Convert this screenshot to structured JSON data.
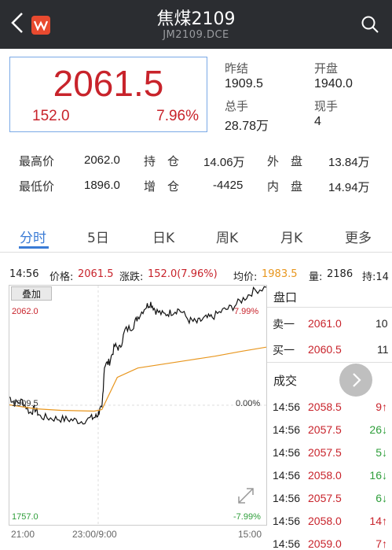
{
  "header": {
    "title": "焦煤2109",
    "subtitle": "JM2109.DCE",
    "logo_letter": "W"
  },
  "quote": {
    "price": "2061.5",
    "change": "152.0",
    "change_pct": "7.96%",
    "prev_close_label": "昨结",
    "prev_close": "1909.5",
    "open_label": "开盘",
    "open": "1940.0",
    "total_vol_label": "总手",
    "total_vol": "28.78万",
    "cur_vol_label": "现手",
    "cur_vol": "4"
  },
  "stats": {
    "high_label": "最高价",
    "high": "2062.0",
    "low_label": "最低价",
    "low": "1896.0",
    "oi_label": "持　仓",
    "oi": "14.06万",
    "oi_chg_label": "增　仓",
    "oi_chg": "-4425",
    "outer_label": "外　盘",
    "outer": "13.84万",
    "inner_label": "内　盘",
    "inner": "14.94万"
  },
  "tabs": [
    "分时",
    "5日",
    "日K",
    "周K",
    "月K",
    "更多"
  ],
  "infobar": {
    "time": "14:56",
    "price_label": "价格:",
    "price": "2061.5",
    "chg_label": "涨跌:",
    "chg": "152.0(7.96%)",
    "avg_label": "均价:",
    "avg": "1983.5",
    "vol_label": "量:",
    "vol": "2186",
    "oi_label": "持:14"
  },
  "chart": {
    "overlay_label": "叠加",
    "y_top": "2062.0",
    "y_mid": "1909.5",
    "y_bottom": "1757.0",
    "pct_top": "7.99%",
    "pct_mid": "0.00%",
    "pct_bottom": "-7.99%",
    "x_labels": [
      "21:00",
      "23:00/9:00",
      "15:00"
    ]
  },
  "chart_data": {
    "type": "line",
    "ylim": [
      1757.0,
      2062.0
    ],
    "xlabel": "",
    "ylabel": "",
    "x": [
      "21:00",
      "23:00/9:00",
      "15:00"
    ],
    "series": [
      {
        "color": "#111111"
      },
      {
        "color": "#e8961e"
      }
    ]
  },
  "orderbook": {
    "title": "盘口",
    "ask_label": "卖一",
    "ask_price": "2061.0",
    "ask_vol": "10",
    "bid_label": "买一",
    "bid_price": "2060.5",
    "bid_vol": "11"
  },
  "trades": {
    "title": "成交",
    "rows": [
      {
        "time": "14:56",
        "price": "2058.5",
        "vol": "9↑",
        "dir": "up"
      },
      {
        "time": "14:56",
        "price": "2057.5",
        "vol": "26↓",
        "dir": "down"
      },
      {
        "time": "14:56",
        "price": "2057.5",
        "vol": "5↓",
        "dir": "down"
      },
      {
        "time": "14:56",
        "price": "2058.0",
        "vol": "16↓",
        "dir": "down"
      },
      {
        "time": "14:56",
        "price": "2057.5",
        "vol": "6↓",
        "dir": "down"
      },
      {
        "time": "14:56",
        "price": "2058.0",
        "vol": "14↑",
        "dir": "up"
      },
      {
        "time": "14:56",
        "price": "2059.0",
        "vol": "7↑",
        "dir": "up"
      }
    ]
  },
  "colors": {
    "up": "#c8232b",
    "down": "#2e9e3a",
    "accent": "#3a7bd5",
    "avg_line": "#e8961e",
    "header_bg": "#2b2d31"
  },
  "icons": {
    "back": "chevron-left-icon",
    "search": "search-icon",
    "zoom": "expand-diagonal-icon",
    "fab": "chevron-right-icon"
  }
}
